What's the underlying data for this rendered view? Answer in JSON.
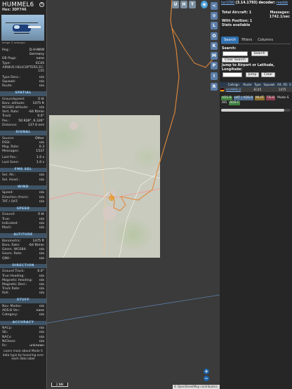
{
  "aircraft": {
    "callsign": "HUMMEL6",
    "hex_label": "Hex:",
    "hex": "3DF746",
    "photo_credit": "Image © adlanger",
    "details": [
      {
        "k": "Reg.:",
        "v": "D-HHWW"
      },
      {
        "k": "",
        "v": "Germany"
      },
      {
        "k": "DB flags:",
        "v": "none"
      },
      {
        "k": "Type:",
        "v": "EC45"
      }
    ],
    "manufacturer": "AIRBUS HELICOPTERS EC-145",
    "details2": [
      {
        "k": "Type Desc.:",
        "v": "n/a"
      },
      {
        "k": "Squawk:",
        "v": "n/a"
      },
      {
        "k": "Route:",
        "v": "n/a"
      }
    ]
  },
  "sections": [
    {
      "title": "SPATIAL",
      "rows": [
        {
          "k": "Groundspeed:",
          "v": "0 kt"
        },
        {
          "k": "Baro. altitude:",
          "v": "1475 ft"
        },
        {
          "k": "WGS84 altitude:",
          "v": "n/a"
        },
        {
          "k": "Vert. Rate:",
          "v": "-64 ft/min"
        },
        {
          "k": "Track:",
          "v": "0.0°"
        },
        {
          "k": "Pos.:",
          "v": "50.928°, 6.326°"
        },
        {
          "k": "Distance:",
          "v": "137.0 nmi"
        }
      ]
    },
    {
      "title": "SIGNAL",
      "rows": [
        {
          "k": "Source:",
          "v": "Other"
        },
        {
          "k": "RSSI:",
          "v": "n/a"
        },
        {
          "k": "Msg. Rate:",
          "v": "0.3"
        },
        {
          "k": "Messages:",
          "v": "1537"
        },
        {
          "gap": true
        },
        {
          "k": "Last Pos.:",
          "v": "1.0 s"
        },
        {
          "k": "Last Seen:",
          "v": "1.0 s"
        }
      ]
    },
    {
      "title": "FMS SEL",
      "rows": [
        {
          "k": "Sel. Alt.:",
          "v": "n/a"
        },
        {
          "k": "Sel. Head.:",
          "v": "n/a"
        }
      ]
    },
    {
      "title": "WIND",
      "rows": [
        {
          "k": "Speed:",
          "v": "n/a"
        },
        {
          "k": "Direction (from):",
          "v": "n/a"
        },
        {
          "k": "TAT / OAT:",
          "v": "n/a"
        }
      ]
    },
    {
      "title": "SPEED",
      "rows": [
        {
          "k": "Ground:",
          "v": "0 kt"
        },
        {
          "k": "True:",
          "v": "n/a"
        },
        {
          "k": "Indicated:",
          "v": "n/a"
        },
        {
          "k": "Mach:",
          "v": "n/a"
        }
      ]
    },
    {
      "title": "ALTITUDE",
      "rows": [
        {
          "k": "Barometric:",
          "v": "1475 ft"
        },
        {
          "k": "Baro. Rate:",
          "v": "-64 ft/min"
        },
        {
          "k": "Geom. WGS84:",
          "v": "n/a"
        },
        {
          "k": "Geom. Rate:",
          "v": "n/a"
        },
        {
          "k": "QNH:",
          "v": "n/a"
        }
      ]
    },
    {
      "title": "DIRECTION",
      "rows": [
        {
          "k": "Ground Track:",
          "v": "0.0°"
        },
        {
          "k": "True Heading:",
          "v": "n/a"
        },
        {
          "k": "Magnetic Heading:",
          "v": "n/a"
        },
        {
          "k": "Magnetic Decl.:",
          "v": "n/a"
        },
        {
          "k": "Track Rate:",
          "v": "n/a"
        },
        {
          "k": "Roll:",
          "v": "n/a"
        }
      ]
    },
    {
      "title": "STUFF",
      "rows": [
        {
          "k": "Nav. Modes:",
          "v": "n/a"
        },
        {
          "k": "ADS-B Ver.:",
          "v": "none"
        },
        {
          "k": "Category:",
          "v": "n/a"
        }
      ]
    },
    {
      "title": "ACCURACY",
      "rows": [
        {
          "k": "NACp:",
          "v": "n/a"
        },
        {
          "k": "SIL:",
          "v": "n/a"
        },
        {
          "k": "NACv:",
          "v": "n/a"
        },
        {
          "k": "NICbaro:",
          "v": "n/a"
        },
        {
          "k": "Rc:",
          "v": "unknown"
        }
      ]
    }
  ],
  "footnote": "Learn more about Mode S data type by hovering over each data label",
  "map": {
    "buttons": [
      "U",
      "H",
      "T"
    ],
    "zoom_in": "+",
    "zoom_out": "−",
    "scale": "2 NM",
    "attribution": "© OpenStreetMap contributors."
  },
  "toolbar": [
    "<",
    "⊙",
    "L",
    "O",
    "K",
    "M",
    "P",
    "I",
    "R"
  ],
  "panel": {
    "version_link": "tar1090",
    "version": "(3.14.1793)",
    "decoder_label": "decoder:",
    "decoder": "readsb",
    "stats": {
      "total_label": "Total Aircraft: 1",
      "messages_label": "Messages:",
      "messages_rate": "1742.1/sec",
      "with_position": "With Position: 1",
      "stats_available": "Stats available"
    },
    "tabs": [
      "Search",
      "Filters",
      "Columns"
    ],
    "search_label": "Search:",
    "search_button": "Search",
    "clear_search": "Clear Search",
    "jump_label": "Jump to Airport or Latitude, Longitude:",
    "jump_button": "Jump",
    "clear_button": "Clear",
    "table_headers": [
      "",
      "Callsign",
      "Route",
      "Type",
      "Squawk",
      "Alt. (ft)",
      "S"
    ],
    "table_rows": [
      {
        "callsign": "HUMMEL6",
        "route": "",
        "type": "EC45",
        "squawk": "",
        "alt": "1475"
      }
    ],
    "legend": [
      {
        "label": "ADS-B",
        "color": "#3f7f3f"
      },
      {
        "label": "UAT / ADS-R",
        "color": "#4c6d8f"
      },
      {
        "label": "MLAT",
        "color": "#8a6d2c"
      },
      {
        "label": "TIS-B",
        "color": "#8c3a4d"
      },
      {
        "label": "Mode-S",
        "color": "#262626"
      },
      {
        "label": "AIS",
        "color": "#262626"
      },
      {
        "label": "ADS-C",
        "color": "#3f7f3f"
      }
    ]
  }
}
